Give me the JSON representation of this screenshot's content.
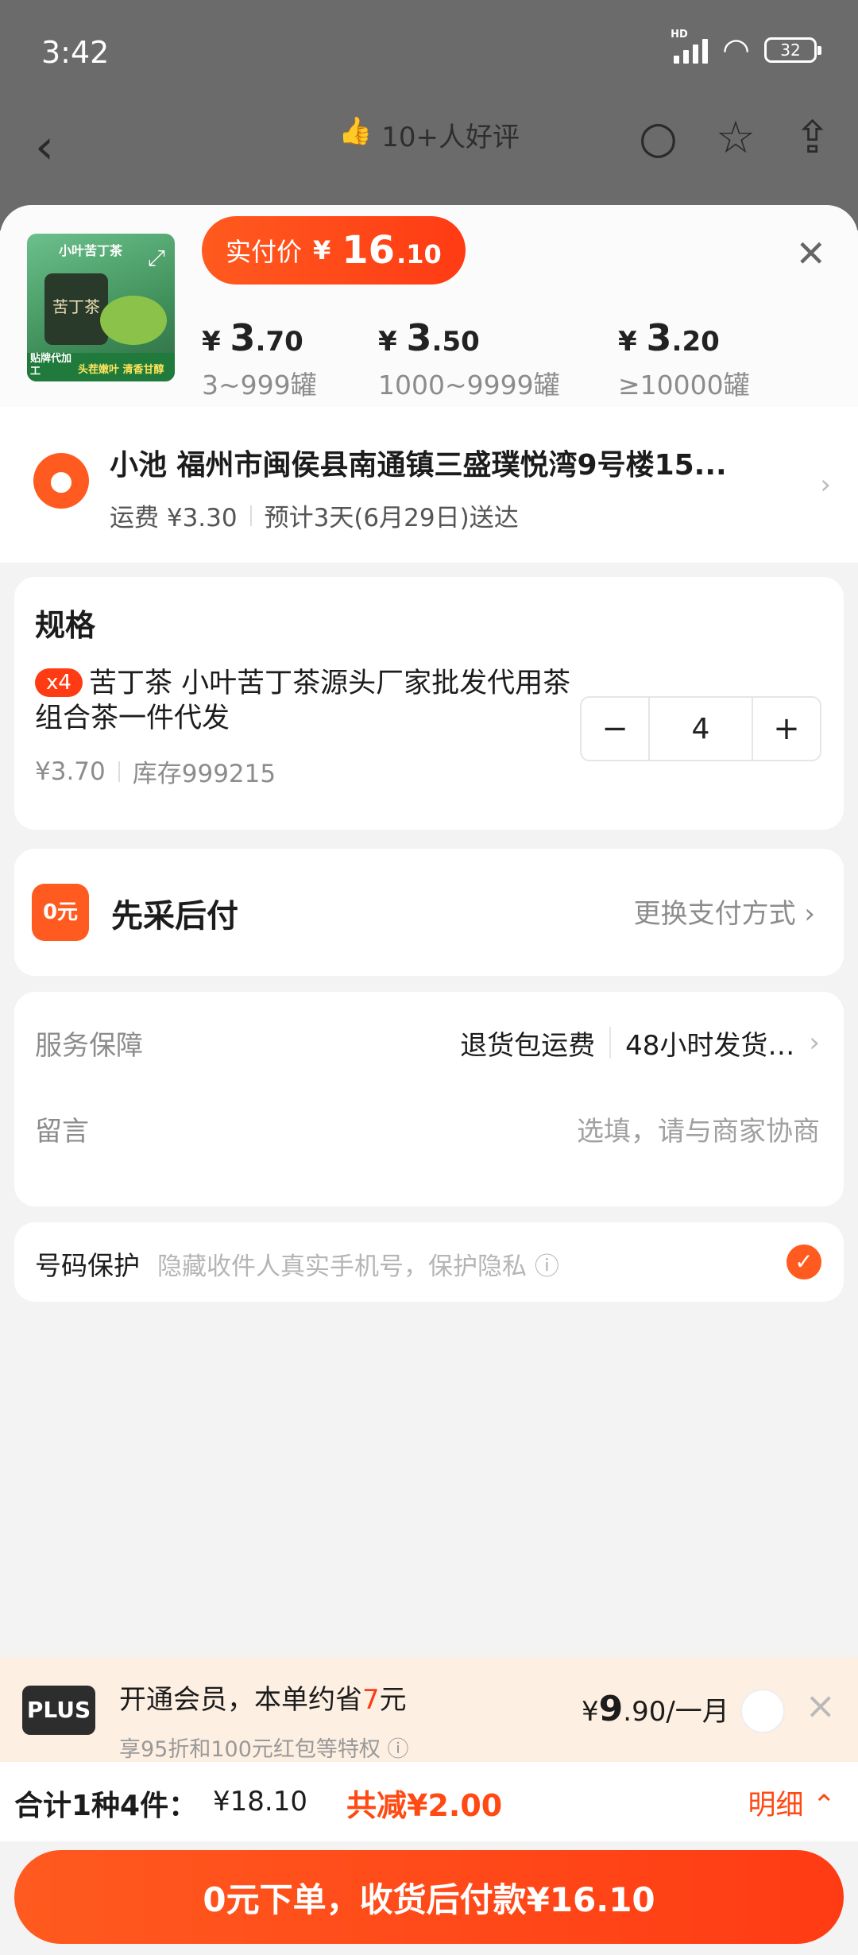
{
  "status_bar": {
    "time": "3:42",
    "signal": "HD",
    "battery": "32"
  },
  "top_nav": {
    "back_icon": "chevron-left-icon",
    "thumb_icon": "thumbs-up-icon",
    "reviews": "10+人好评",
    "search_icon": "search-icon",
    "fav_icon": "star-icon",
    "share_icon": "share-icon"
  },
  "product": {
    "image_caption_top": "小叶苦丁茶",
    "image_jar_label": "苦丁茶",
    "image_band": "头茬嫩叶 清香甘醇",
    "image_corner": "贴牌代加工",
    "pay_label": "实付价",
    "pay_currency": "¥",
    "pay_int": "16",
    "pay_dec": ".10",
    "tiers": [
      {
        "currency": "¥",
        "int": "3",
        "dec": ".70",
        "range": "3~999罐"
      },
      {
        "currency": "¥",
        "int": "3",
        "dec": ".50",
        "range": "1000~9999罐"
      },
      {
        "currency": "¥",
        "int": "3",
        "dec": ".20",
        "range": "≥10000罐"
      }
    ]
  },
  "address": {
    "line": "小池  福州市闽侯县南通镇三盛璞悦湾9号楼15...",
    "freight": "运费 ¥3.30",
    "eta": "预计3天(6月29日)送达"
  },
  "spec": {
    "title": "规格",
    "badge": "x4",
    "name": "苦丁茶 小叶苦丁茶源头厂家批发代用茶组合茶一件代发",
    "unit_price": "¥3.70",
    "stock": "库存999215",
    "qty": "4",
    "minus": "−",
    "plus": "+"
  },
  "payment": {
    "icon_text": "0元",
    "label": "先采后付",
    "change": "更换支付方式 ›"
  },
  "service": {
    "k1": "服务保障",
    "v1a": "退货包运费",
    "v1b": "48小时发货…",
    "chev": "›",
    "k2": "留言",
    "placeholder": "选填，请与商家协商"
  },
  "privacy": {
    "label": "号码保护",
    "hint": "隐藏收件人真实手机号，保护隐私 ⓘ",
    "check": "✓"
  },
  "plus": {
    "logo": "PLUS",
    "line1_pre": "开通会员，本单约省",
    "line1_num": "7",
    "line1_post": "元",
    "line2": "享95折和100元红包等特权 ⓘ",
    "price_pre": "¥",
    "price_int": "9",
    "price_post": ".90/一月",
    "close": "×"
  },
  "totals": {
    "label": "合计1种4件：",
    "amount": "¥18.10",
    "discount": "共减¥2.00",
    "detail": "明细 ⌃"
  },
  "cta": "0元下单，收货后付款¥16.10"
}
